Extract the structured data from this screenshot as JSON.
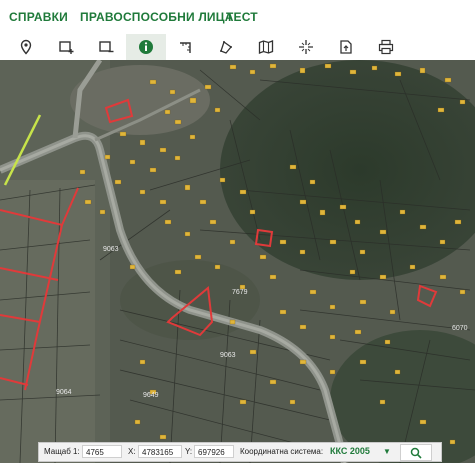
{
  "nav": {
    "items": [
      {
        "label": "СПРАВКИ"
      },
      {
        "label": "ПРАВОСПОСОБНИ ЛИЦА"
      },
      {
        "label": "ТЕСТ"
      }
    ]
  },
  "toolbar": {
    "tools": [
      {
        "icon": "map-pin-icon"
      },
      {
        "icon": "select-rect-plus-icon"
      },
      {
        "icon": "select-rect-minus-icon"
      },
      {
        "icon": "info-icon",
        "active": true
      },
      {
        "icon": "measure-length-icon"
      },
      {
        "icon": "measure-area-icon"
      },
      {
        "icon": "map-layers-icon"
      },
      {
        "icon": "crosshair-icon"
      },
      {
        "icon": "export-icon"
      },
      {
        "icon": "print-icon"
      }
    ]
  },
  "map": {
    "parcel_labels": [
      {
        "text": "9063"
      },
      {
        "text": "7679"
      },
      {
        "text": "9063"
      },
      {
        "text": "9064"
      },
      {
        "text": "9649"
      },
      {
        "text": "6070"
      }
    ]
  },
  "statusbar": {
    "scale_label": "Мащаб 1:",
    "scale_value": "4765",
    "x_label": "X:",
    "x_value": "4783165",
    "y_label": "Y:",
    "y_value": "697926",
    "crs_label": "Координатна система:",
    "crs_value": "ККС 2005",
    "crs_dropdown_icon": "chevron-down-icon",
    "search_icon": "search-icon"
  },
  "colors": {
    "accent": "#1f7a3a",
    "parcel_red": "#e03a3a",
    "road_yellow": "#c7e34a"
  }
}
